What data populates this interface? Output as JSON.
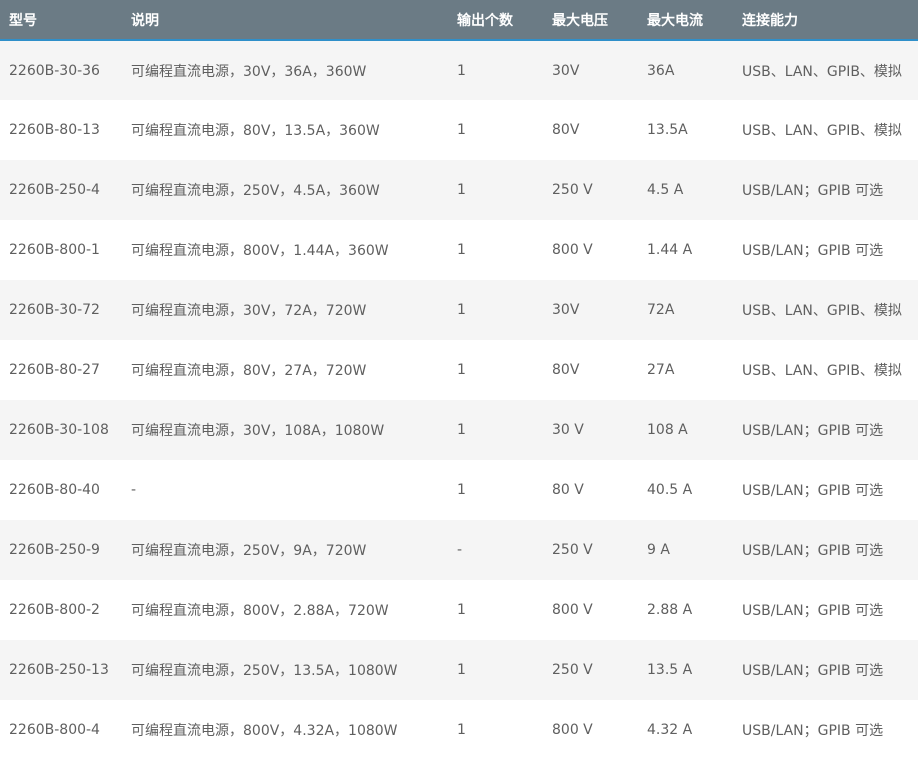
{
  "table": {
    "headers": [
      "型号",
      "说明",
      "输出个数",
      "最大电压",
      "最大电流",
      "连接能力"
    ],
    "rows": [
      [
        "2260B-30-36",
        "可编程直流电源，30V，36A，360W",
        "1",
        "30V",
        "36A",
        "USB、LAN、GPIB、模拟"
      ],
      [
        "2260B-80-13",
        "可编程直流电源，80V，13.5A，360W",
        "1",
        "80V",
        "13.5A",
        "USB、LAN、GPIB、模拟"
      ],
      [
        "2260B-250-4",
        "可编程直流电源，250V，4.5A，360W",
        "1",
        "250 V",
        "4.5 A",
        "USB/LAN；GPIB 可选"
      ],
      [
        "2260B-800-1",
        "可编程直流电源，800V，1.44A，360W",
        "1",
        "800 V",
        "1.44 A",
        "USB/LAN；GPIB 可选"
      ],
      [
        "2260B-30-72",
        "可编程直流电源，30V，72A，720W",
        "1",
        "30V",
        "72A",
        "USB、LAN、GPIB、模拟"
      ],
      [
        "2260B-80-27",
        "可编程直流电源，80V，27A，720W",
        "1",
        "80V",
        "27A",
        "USB、LAN、GPIB、模拟"
      ],
      [
        "2260B-30-108",
        "可编程直流电源，30V，108A，1080W",
        "1",
        "30 V",
        "108 A",
        "USB/LAN；GPIB 可选"
      ],
      [
        "2260B-80-40",
        "-",
        "1",
        "80 V",
        "40.5 A",
        "USB/LAN；GPIB 可选"
      ],
      [
        "2260B-250-9",
        "可编程直流电源，250V，9A，720W",
        "-",
        "250 V",
        "9 A",
        "USB/LAN；GPIB 可选"
      ],
      [
        "2260B-800-2",
        "可编程直流电源，800V，2.88A，720W",
        "1",
        "800 V",
        "2.88 A",
        "USB/LAN；GPIB 可选"
      ],
      [
        "2260B-250-13",
        "可编程直流电源，250V，13.5A，1080W",
        "1",
        "250 V",
        "13.5 A",
        "USB/LAN；GPIB 可选"
      ],
      [
        "2260B-800-4",
        "可编程直流电源，800V，4.32A，1080W",
        "1",
        "800 V",
        "4.32 A",
        "USB/LAN；GPIB 可选"
      ]
    ]
  },
  "colors": {
    "header_bg": "#6b7b85",
    "header_border": "#2f8fc9",
    "row_odd_bg": "#f5f5f5",
    "row_even_bg": "#ffffff",
    "text": "#5f5f5f"
  }
}
